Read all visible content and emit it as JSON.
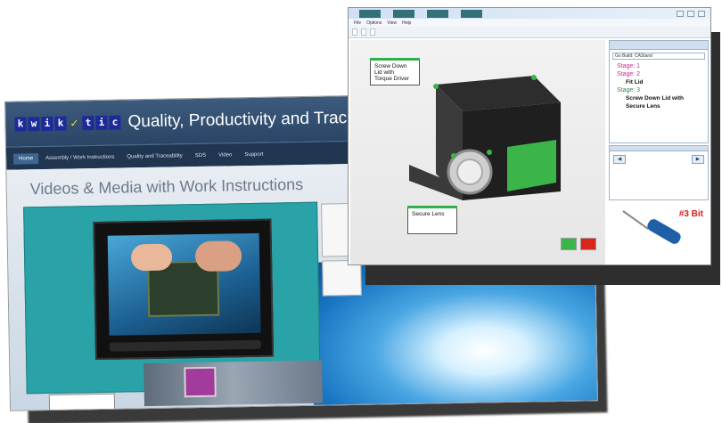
{
  "website": {
    "logo_letters_1": [
      "k",
      "w",
      "i",
      "k"
    ],
    "logo_letters_2": [
      "t",
      "i",
      "c"
    ],
    "title": "Quality, Productivity and Traceab",
    "nav": [
      "Home",
      "Assembly / Work Instructions",
      "Quality and Traceability",
      "SDS",
      "Video",
      "Support"
    ],
    "heading": "Videos & Media with Work Instructions"
  },
  "app": {
    "menu": [
      "File",
      "Options",
      "View",
      "Help"
    ],
    "callouts": {
      "screw": [
        "Screw Down",
        "Lid with",
        "Torque Driver"
      ],
      "lens": "Secure Lens"
    },
    "tree": {
      "search": "Go Build: CAStand",
      "stage1": "Stage: 1",
      "stage2": "Stage: 2",
      "stage2_items": [
        "Fit Lid"
      ],
      "stage3": "Stage: 3",
      "stage3_items": [
        "Screw Down Lid with",
        "Secure Lens"
      ]
    },
    "bit_label": "#3 Bit"
  },
  "colors": {
    "accent_green": "#3bb54a",
    "accent_red": "#d9251c",
    "stage_magenta": "#cc2b8e",
    "header_blue": "#2a4566"
  }
}
